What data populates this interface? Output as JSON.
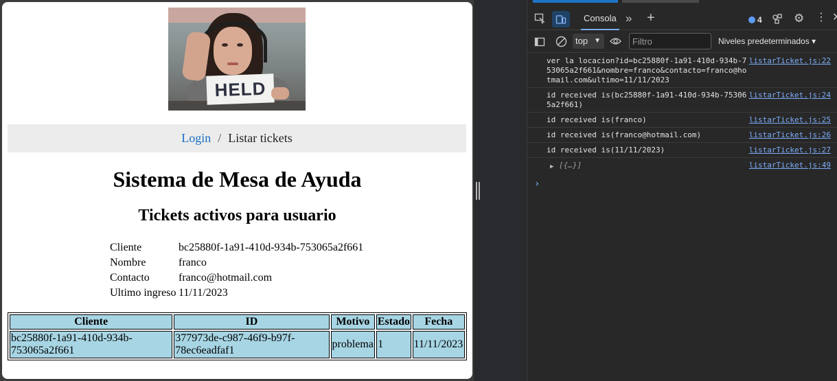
{
  "webpage": {
    "hero_sign_text": "HELD",
    "breadcrumb": {
      "link": "Login",
      "separator": "/",
      "current": "Listar tickets"
    },
    "title": "Sistema de Mesa de Ayuda",
    "subtitle": "Tickets activos para usuario",
    "info": [
      {
        "label": "Cliente",
        "value": "bc25880f-1a91-410d-934b-753065a2f661"
      },
      {
        "label": "Nombre",
        "value": "franco"
      },
      {
        "label": "Contacto",
        "value": "franco@hotmail.com"
      },
      {
        "label": "Ultimo ingreso",
        "value": "11/11/2023"
      }
    ],
    "table": {
      "headers": [
        "Cliente",
        "ID",
        "Motivo",
        "Estado",
        "Fecha"
      ],
      "rows": [
        [
          "bc25880f-1a91-410d-934b-753065a2f661",
          "377973de-c987-46f9-b97f-78ec6eadfaf1",
          "problema",
          "1",
          "11/11/2023"
        ]
      ]
    },
    "colors": {
      "table_cell_bg": "#a7d5e4",
      "link": "#1a6fc4",
      "breadcrumb_bg": "#ececec"
    }
  },
  "devtools": {
    "tabs": {
      "console": "Consola"
    },
    "issues_count": "4",
    "context": "top",
    "filter_placeholder": "Filtro",
    "levels_label": "Niveles predeterminados",
    "log": [
      {
        "message": "ver la locacion?id=bc25880f-1a91-410d-934b-753065a2f661&nombre=franco&contacto=franco@hotmail.com&ultimo=11/11/2023",
        "source": "listarTicket.js:22"
      },
      {
        "message": "id received is(bc25880f-1a91-410d-934b-753065a2f661)",
        "source": "listarTicket.js:24"
      },
      {
        "message": "id received is(franco)",
        "source": "listarTicket.js:25"
      },
      {
        "message": "id received is(franco@hotmail.com)",
        "source": "listarTicket.js:26"
      },
      {
        "message": "id received is(11/11/2023)",
        "source": "listarTicket.js:27"
      },
      {
        "message": "[{…}]",
        "source": "listarTicket.js:49"
      }
    ],
    "icons": [
      "inspect-icon",
      "device-toggle-icon",
      "more-tabs-icon",
      "add-tab-icon",
      "issues-icon",
      "customize-icon",
      "settings-icon",
      "kebab-icon",
      "sidebar-icon",
      "clear-icon",
      "eye-icon"
    ]
  }
}
